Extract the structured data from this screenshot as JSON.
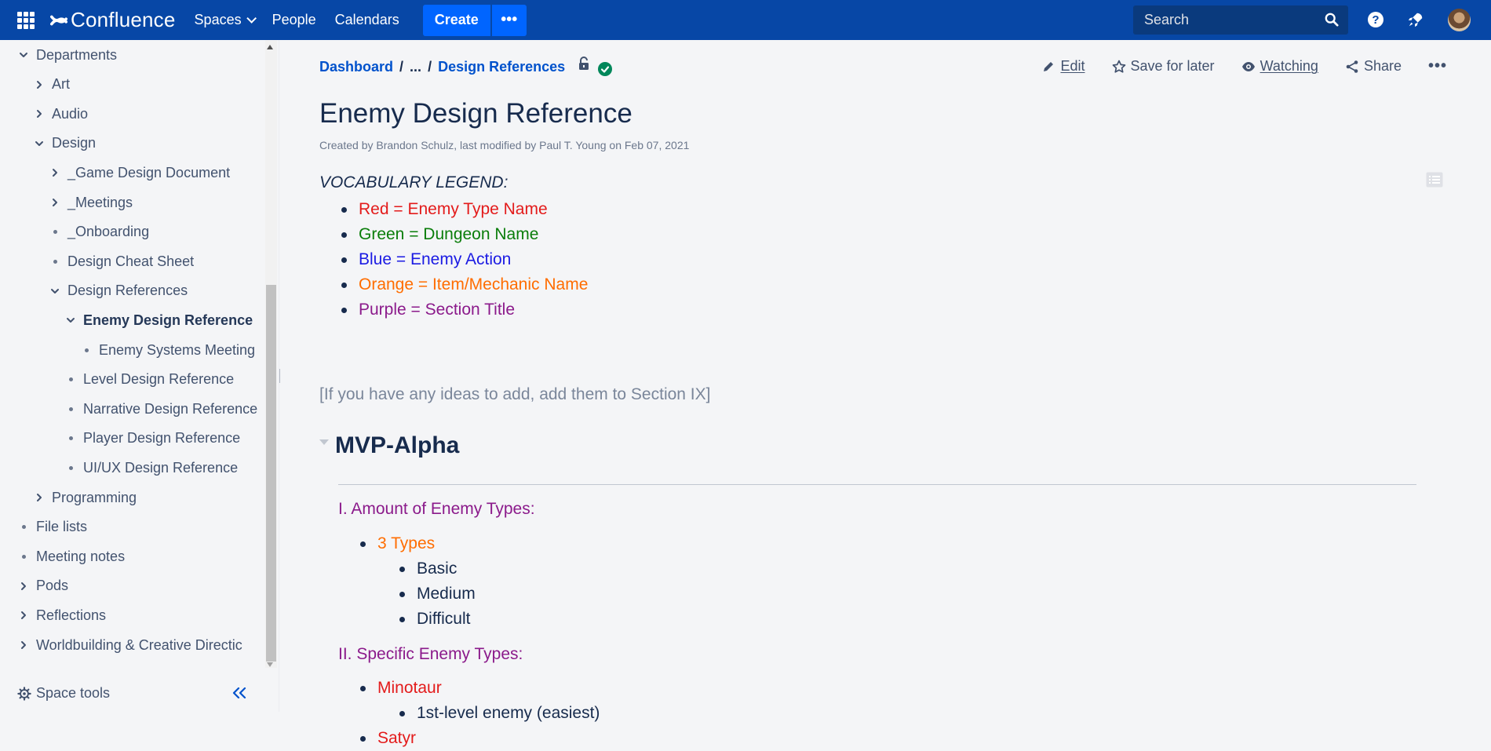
{
  "topnav": {
    "brand": "Confluence",
    "items": [
      "Spaces",
      "People",
      "Calendars"
    ],
    "create_label": "Create",
    "more_label": "•••",
    "search_placeholder": "Search",
    "help_label": "?"
  },
  "sidebar": {
    "tree": [
      {
        "label": "Departments",
        "kind": "open",
        "level": 1
      },
      {
        "label": "Art",
        "kind": "closed",
        "level": 2
      },
      {
        "label": "Audio",
        "kind": "closed",
        "level": 2
      },
      {
        "label": "Design",
        "kind": "open",
        "level": 2
      },
      {
        "label": "_Game Design Document",
        "kind": "closed",
        "level": 3
      },
      {
        "label": "_Meetings",
        "kind": "closed",
        "level": 3
      },
      {
        "label": "_Onboarding",
        "kind": "leaf",
        "level": 3
      },
      {
        "label": "Design Cheat Sheet",
        "kind": "leaf",
        "level": 3
      },
      {
        "label": "Design References",
        "kind": "open",
        "level": 3
      },
      {
        "label": "Enemy Design Reference",
        "kind": "open",
        "level": 4,
        "active": true
      },
      {
        "label": "Enemy Systems Meeting",
        "kind": "leaf",
        "level": 5
      },
      {
        "label": "Level Design Reference",
        "kind": "leaf",
        "level": 4
      },
      {
        "label": "Narrative Design Reference",
        "kind": "leaf",
        "level": 4
      },
      {
        "label": "Player Design Reference",
        "kind": "leaf",
        "level": 4
      },
      {
        "label": "UI/UX Design Reference",
        "kind": "leaf",
        "level": 4
      },
      {
        "label": "Programming",
        "kind": "closed",
        "level": 2
      },
      {
        "label": "File lists",
        "kind": "leaf",
        "level": 1
      },
      {
        "label": "Meeting notes",
        "kind": "leaf",
        "level": 1
      },
      {
        "label": "Pods",
        "kind": "closed",
        "level": 1
      },
      {
        "label": "Reflections",
        "kind": "closed",
        "level": 1
      },
      {
        "label": "Worldbuilding & Creative Directic",
        "kind": "closed",
        "level": 1
      }
    ],
    "space_tools": "Space tools"
  },
  "breadcrumb": {
    "dashboard": "Dashboard",
    "ellipsis": "...",
    "parent": "Design References"
  },
  "actions": {
    "edit": "Edit",
    "save": "Save for later",
    "watching": "Watching",
    "share": "Share",
    "more": "•••"
  },
  "page": {
    "title": "Enemy Design Reference",
    "byline": "Created by Brandon Schulz, last modified by Paul T. Young on Feb 07, 2021",
    "legend_title": "VOCABULARY LEGEND:",
    "legend": [
      {
        "text": "Red = Enemy Type Name",
        "color": "#e31b1b"
      },
      {
        "text": "Green = Dungeon Name",
        "color": "#0a7d0a"
      },
      {
        "text": "Blue = Enemy Action",
        "color": "#1b1be3"
      },
      {
        "text": "Orange = Item/Mechanic Name",
        "color": "#ff6d00"
      },
      {
        "text": "Purple = Section Title",
        "color": "#8b1a8b"
      }
    ],
    "note": "[If you have any ideas to add, add them to Section IX]",
    "section": "MVP-Alpha",
    "sec1_title": "I. Amount of Enemy Types:",
    "sec1_item": "3 Types",
    "sec1_sub": [
      "Basic",
      "Medium",
      "Difficult"
    ],
    "sec2_title": "II. Specific Enemy Types:",
    "sec2_items": [
      {
        "text": "Minotaur",
        "sub": "1st-level enemy (easiest)"
      },
      {
        "text": "Satyr"
      }
    ]
  }
}
